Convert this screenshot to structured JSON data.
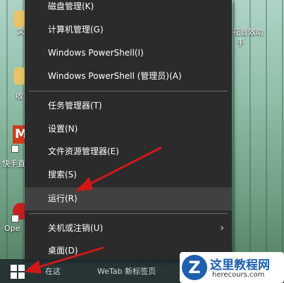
{
  "desktop": {
    "icons": [
      {
        "name": "folder-icon",
        "label": "文"
      },
      {
        "name": "folder-icon",
        "label": "收"
      },
      {
        "name": "app-icon",
        "label": "快手直"
      },
      {
        "name": "app-icon",
        "label": "Ope"
      }
    ],
    "right_label_line1": "花音效助",
    "right_label_line2": "手"
  },
  "context_menu": {
    "items": [
      {
        "label": "磁盘管理(K)"
      },
      {
        "label": "计算机管理(G)"
      },
      {
        "label": "Windows PowerShell(I)"
      },
      {
        "label": "Windows PowerShell (管理员)(A)"
      },
      {
        "label": "任务管理器(T)"
      },
      {
        "label": "设置(N)"
      },
      {
        "label": "文件资源管理器(E)"
      },
      {
        "label": "搜索(S)"
      },
      {
        "label": "运行(R)",
        "highlighted": true
      },
      {
        "label": "关机或注销(U)",
        "has_submenu": true
      },
      {
        "label": "桌面(D)"
      }
    ]
  },
  "taskbar": {
    "search_text": "在这",
    "app_text": "WeTab 新标签页"
  },
  "watermark": {
    "logo_letter": "Z",
    "title": "这里教程网",
    "subtitle": "herecours.com"
  },
  "colors": {
    "menu_bg": "#2b2b2b",
    "menu_hover": "#414141",
    "arrow": "#d01818",
    "watermark_blue": "#1e5fae"
  }
}
